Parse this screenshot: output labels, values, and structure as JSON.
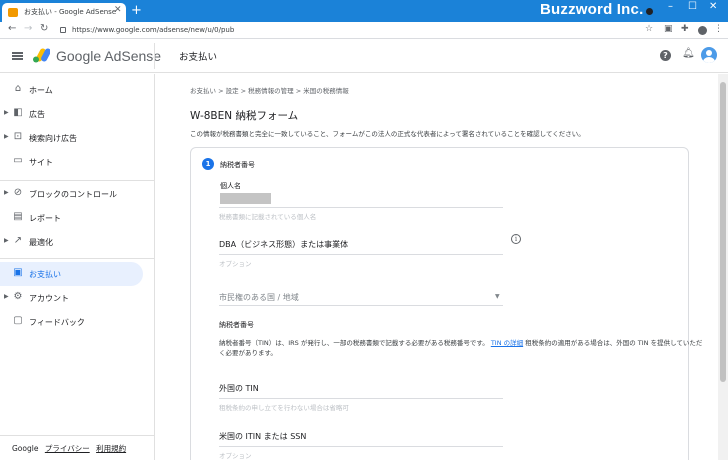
{
  "browser": {
    "tab_title": "お支払い - Google AdSense",
    "new_tab": "+",
    "url": "https://www.google.com/adsense/new/u/0/pub",
    "watermark": "Buzzword Inc.",
    "window_controls": {
      "minimize": "–",
      "maximize": "☐",
      "close": "✕"
    }
  },
  "header": {
    "brand": "Google AdSense",
    "page_title": "お支払い",
    "help": "?"
  },
  "sidebar": {
    "items": [
      {
        "label": "ホーム",
        "icon": "home-icon",
        "has_caret": false
      },
      {
        "label": "広告",
        "icon": "ads-icon",
        "has_caret": true
      },
      {
        "label": "検索向け広告",
        "icon": "search-ads-icon",
        "has_caret": true
      },
      {
        "label": "サイト",
        "icon": "sites-icon",
        "has_caret": false
      },
      {
        "label": "ブロックのコントロール",
        "icon": "block-icon",
        "has_caret": true
      },
      {
        "label": "レポート",
        "icon": "reports-icon",
        "has_caret": false
      },
      {
        "label": "最適化",
        "icon": "optimization-icon",
        "has_caret": true
      },
      {
        "label": "お支払い",
        "icon": "payments-icon",
        "has_caret": false,
        "active": true
      },
      {
        "label": "アカウント",
        "icon": "account-icon",
        "has_caret": true
      },
      {
        "label": "フィードバック",
        "icon": "feedback-icon",
        "has_caret": false
      }
    ],
    "footer": {
      "brand": "Google",
      "privacy": "プライバシー",
      "terms": "利用規約"
    }
  },
  "main": {
    "breadcrumb": "お支払い  >  設定  >  税務情報の管理  >  米国の税務情報",
    "title": "W-8BEN 納税フォーム",
    "description": "この情報が税務書類と完全に一致していること、フォームがこの法人の正式な代表者によって署名されていることを確認してください。",
    "step": {
      "number": "1",
      "title": "納税者番号",
      "individual_name_label": "個人名",
      "individual_name_hint": "税務書類に記載されている個人名",
      "dba_label": "DBA（ビジネス形態）または事業体",
      "dba_hint": "オプション",
      "citizenship_placeholder": "市民権のある国 / 地域",
      "tin_section_label": "納税者番号",
      "tin_desc_before": "納税者番号（TIN）は、IRS が発行し、一部の税務書類で記載する必要がある税務番号です。",
      "tin_link": "TIN の詳細",
      "tin_desc_after": "租税条約の適用がある場合は、外国の TIN を提供していただく必要があります。",
      "foreign_tin_label": "外国の TIN",
      "foreign_tin_hint": "租税条約の申し立てを行わない場合は省略可",
      "us_itin_label": "米国の ITIN または SSN",
      "us_itin_hint": "オプション"
    }
  }
}
